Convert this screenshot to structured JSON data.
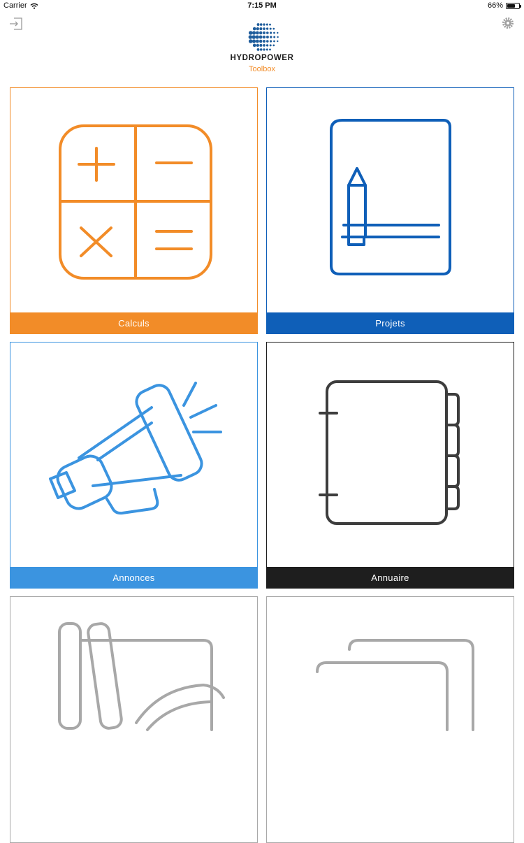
{
  "status_bar": {
    "carrier": "Carrier",
    "time": "7:15 PM",
    "battery": "66%",
    "battery_level": 0.66
  },
  "header": {
    "brand": "HYDROPOWER",
    "subtitle": "Toolbox",
    "logout_icon": "logout-icon",
    "settings_icon": "gear-icon"
  },
  "tiles": [
    {
      "label": "Calculs",
      "color": "#f28c28",
      "icon": "calculator-icon"
    },
    {
      "label": "Projets",
      "color": "#0f5fb8",
      "icon": "notebook-pencil-icon"
    },
    {
      "label": "Annonces",
      "color": "#3b94e0",
      "icon": "megaphone-icon"
    },
    {
      "label": "Annuaire",
      "color": "#1e1e1e",
      "icon": "address-book-icon"
    },
    {
      "label": "",
      "color": "#a8a8a8",
      "icon": "tools-icon"
    },
    {
      "label": "",
      "color": "#a8a8a8",
      "icon": "folders-icon"
    }
  ]
}
